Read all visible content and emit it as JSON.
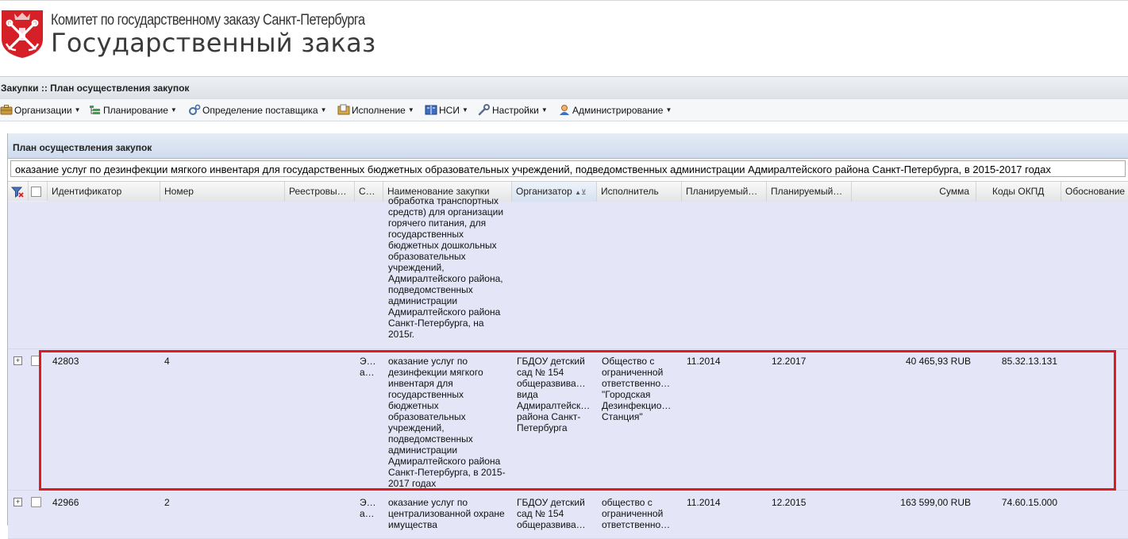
{
  "header": {
    "committee": "Комитет по государственному заказу Санкт-Петербурга",
    "title": "Государственный заказ",
    "emblem_colors": {
      "red": "#d62027",
      "white": "#ffffff"
    }
  },
  "breadcrumb": "Закупки :: План осуществления закупок",
  "menu": [
    {
      "label": "Организации",
      "icon": "briefcase-icon"
    },
    {
      "label": "Планирование",
      "icon": "list-tree-icon"
    },
    {
      "label": "Определение поставщика",
      "icon": "gears-icon"
    },
    {
      "label": "Исполнение",
      "icon": "folder-docs-icon"
    },
    {
      "label": "НСИ",
      "icon": "book-icon"
    },
    {
      "label": "Настройки",
      "icon": "wrench-icon"
    },
    {
      "label": "Администрирование",
      "icon": "user-icon"
    }
  ],
  "panel": {
    "title": "План осуществления закупок",
    "filter_value": "оказание услуг по дезинфекции мягкого инвентаря для государственных бюджетных образовательных учреждений, подведомственных администрации Адмиралтейского района Санкт-Петербурга, в 2015-2017 годах"
  },
  "columns": {
    "id": "Идентификатор",
    "number": "Номер",
    "registry": "Реестровы…",
    "status": "С…",
    "name": "Наименование закупки",
    "organizer": "Организатор",
    "executor": "Исполнитель",
    "plan_start": "Планируемый…",
    "plan_end": "Планируемый…",
    "sum": "Сумма",
    "okpd": "Коды ОКПД",
    "basis": "Обоснование"
  },
  "rows": [
    {
      "id": "",
      "number": "",
      "status": "",
      "name": "обработка транспортных средств) для организации горячего питания, для государственных бюджетных дошкольных образовательных учреждений, Адмиралтейского района, подведомственных администрации Адмиралтейского района Санкт-Петербурга, на 2015г.",
      "organizer": "",
      "executor": "",
      "plan_start": "",
      "plan_end": "",
      "sum": "",
      "okpd": ""
    },
    {
      "id": "42803",
      "number": "4",
      "status": "Э… а…",
      "name": "оказание услуг по дезинфекции мягкого инвентаря для государственных бюджетных образовательных учреждений, подведомственных администрации Адмиралтейского района Санкт-Петербурга, в 2015-2017 годах",
      "organizer": "ГБДОУ детский сад № 154 общеразвива… вида Адмиралтейск… района Санкт-Петербурга",
      "executor": "Общество с ограниченной ответственно… \"Городская Дезинфекцио… Станция\"",
      "plan_start": "11.2014",
      "plan_end": "12.2017",
      "sum": "40 465,93 RUB",
      "okpd": "85.32.13.131"
    },
    {
      "id": "42966",
      "number": "2",
      "status": "Э… а…",
      "name": "оказание услуг по централизованной охране имущества",
      "organizer": "ГБДОУ детский сад № 154 общеразвива…",
      "executor": "общество с ограниченной ответственно…",
      "plan_start": "11.2014",
      "plan_end": "12.2015",
      "sum": "163 599,00 RUB",
      "okpd": "74.60.15.000"
    }
  ]
}
